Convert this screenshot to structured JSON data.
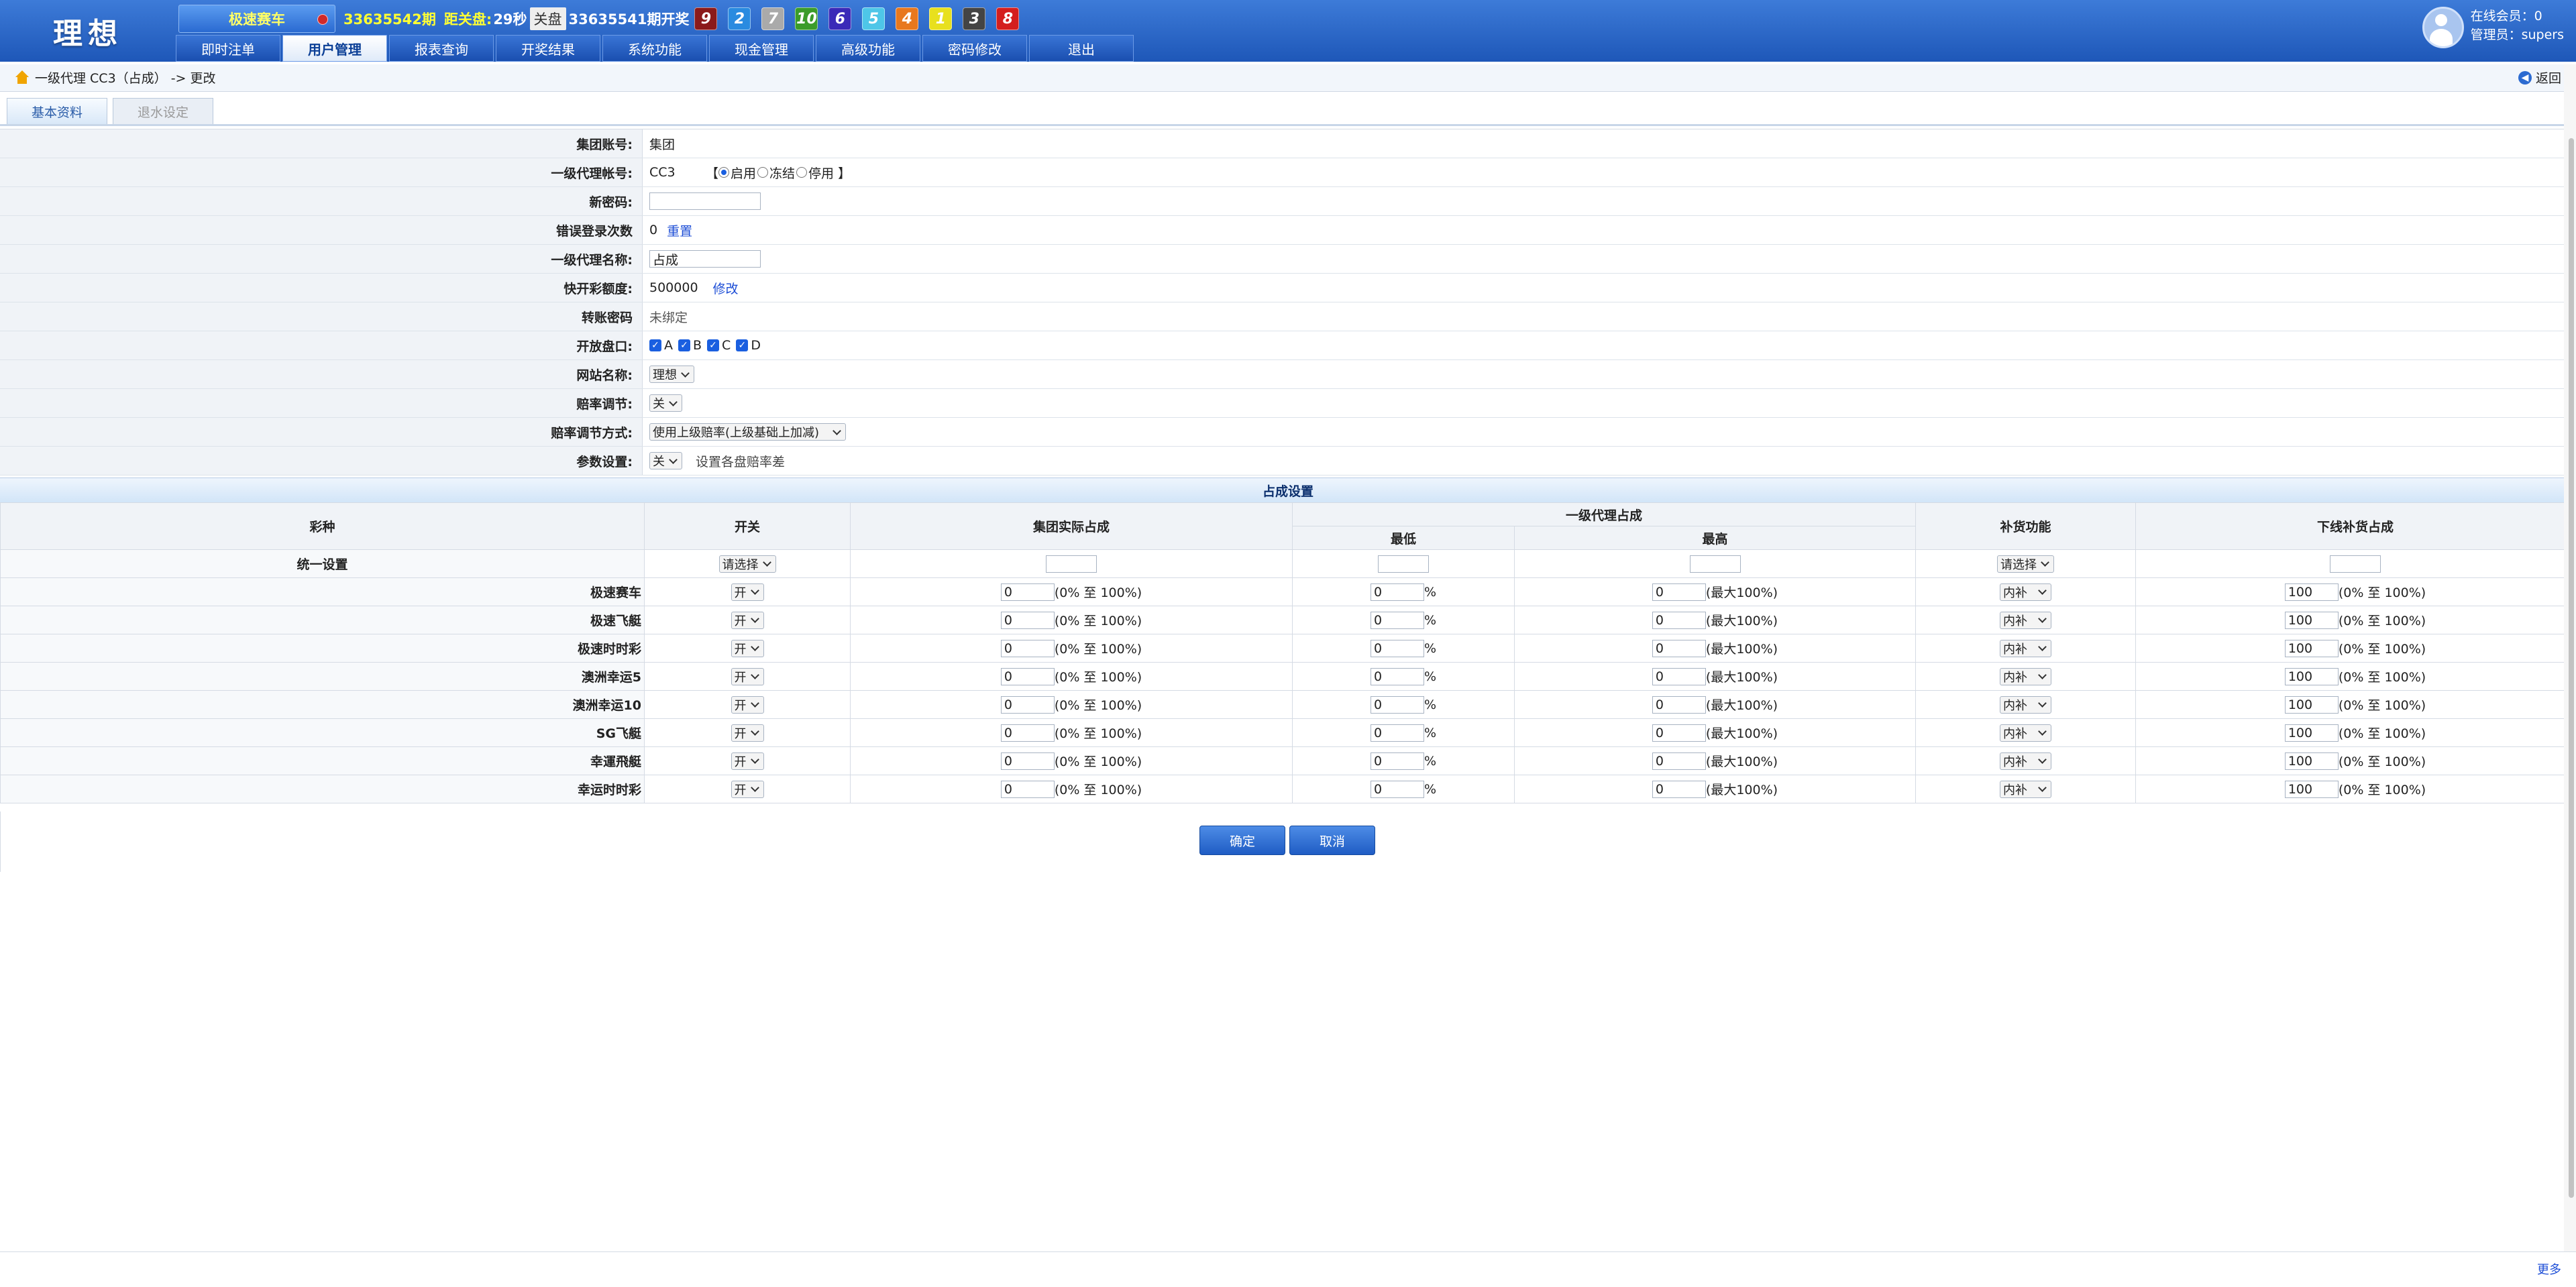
{
  "header": {
    "logo": "理想",
    "game": "极速赛车",
    "current_period": "33635542期",
    "close_label": "距关盘:",
    "close_countdown": "29秒",
    "close_badge": "关盘",
    "last_period": "33635541期开奖",
    "balls": [
      {
        "n": "9",
        "color": "#8b1a1a"
      },
      {
        "n": "2",
        "color": "#2a8be0"
      },
      {
        "n": "7",
        "color": "#aaaaaa"
      },
      {
        "n": "10",
        "color": "#3b9c2a"
      },
      {
        "n": "6",
        "color": "#3a2ab8"
      },
      {
        "n": "5",
        "color": "#4ec6e8"
      },
      {
        "n": "4",
        "color": "#e8781e"
      },
      {
        "n": "1",
        "color": "#e8e01e"
      },
      {
        "n": "3",
        "color": "#444444"
      },
      {
        "n": "8",
        "color": "#d41e1e"
      }
    ],
    "nav": [
      "即时注单",
      "用户管理",
      "报表查询",
      "开奖结果",
      "系统功能",
      "现金管理",
      "高级功能",
      "密码修改",
      "退出"
    ],
    "online_members": "在线会员：0",
    "admin": "管理员：supers"
  },
  "breadcrumb": {
    "text": "一级代理 CC3（占成） -> 更改",
    "back": "返回"
  },
  "tabs": [
    "基本资料",
    "退水设定"
  ],
  "form": {
    "group_account_label": "集团账号:",
    "group_account": "集团",
    "agent_account_label": "一级代理帐号:",
    "agent_account": "CC3",
    "bracket_open": "【",
    "bracket_close": "】",
    "status_enabled": "启用",
    "status_frozen": "冻结",
    "status_disabled": "停用",
    "new_password_label": "新密码:",
    "error_login_label": "错误登录次数",
    "error_login_count": "0",
    "reset_link": "重置",
    "agent_name_label": "一级代理名称:",
    "agent_name": "占成",
    "credit_label": "快开彩额度:",
    "credit": "500000",
    "modify_link": "修改",
    "transfer_pwd_label": "转账密码",
    "transfer_pwd": "未绑定",
    "open_plates_label": "开放盘口:",
    "plates": [
      "A",
      "B",
      "C",
      "D"
    ],
    "site_name_label": "网站名称:",
    "site_name": "理想",
    "odds_adjust_label": "赔率调节:",
    "odds_adjust": "关",
    "odds_mode_label": "赔率调节方式:",
    "odds_mode": "使用上级赔率(上级基础上加减)",
    "param_label": "参数设置:",
    "param_value": "关",
    "param_note": "设置各盘赔率差"
  },
  "share": {
    "section_title": "占成设置",
    "headers": {
      "lottery": "彩种",
      "switch": "开关",
      "group_share": "集团实际占成",
      "agent_share": "一级代理占成",
      "min": "最低",
      "max": "最高",
      "replenish": "补货功能",
      "down_replenish": "下线补货占成"
    },
    "unified_label": "统一设置",
    "please_select": "请选择",
    "rows": [
      {
        "name": "极速赛车",
        "switch": "开",
        "group": "0",
        "group_range": "(0% 至 100%)",
        "min": "0",
        "pct": "%",
        "max": "0",
        "max_note": "(最大100%)",
        "replenish": "内补",
        "down": "100",
        "down_range": "(0% 至 100%)"
      },
      {
        "name": "极速飞艇",
        "switch": "开",
        "group": "0",
        "group_range": "(0% 至 100%)",
        "min": "0",
        "pct": "%",
        "max": "0",
        "max_note": "(最大100%)",
        "replenish": "内补",
        "down": "100",
        "down_range": "(0% 至 100%)"
      },
      {
        "name": "极速时时彩",
        "switch": "开",
        "group": "0",
        "group_range": "(0% 至 100%)",
        "min": "0",
        "pct": "%",
        "max": "0",
        "max_note": "(最大100%)",
        "replenish": "内补",
        "down": "100",
        "down_range": "(0% 至 100%)"
      },
      {
        "name": "澳洲幸运5",
        "switch": "开",
        "group": "0",
        "group_range": "(0% 至 100%)",
        "min": "0",
        "pct": "%",
        "max": "0",
        "max_note": "(最大100%)",
        "replenish": "内补",
        "down": "100",
        "down_range": "(0% 至 100%)"
      },
      {
        "name": "澳洲幸运10",
        "switch": "开",
        "group": "0",
        "group_range": "(0% 至 100%)",
        "min": "0",
        "pct": "%",
        "max": "0",
        "max_note": "(最大100%)",
        "replenish": "内补",
        "down": "100",
        "down_range": "(0% 至 100%)"
      },
      {
        "name": "SG飞艇",
        "switch": "开",
        "group": "0",
        "group_range": "(0% 至 100%)",
        "min": "0",
        "pct": "%",
        "max": "0",
        "max_note": "(最大100%)",
        "replenish": "内补",
        "down": "100",
        "down_range": "(0% 至 100%)"
      },
      {
        "name": "幸運飛艇",
        "switch": "开",
        "group": "0",
        "group_range": "(0% 至 100%)",
        "min": "0",
        "pct": "%",
        "max": "0",
        "max_note": "(最大100%)",
        "replenish": "内补",
        "down": "100",
        "down_range": "(0% 至 100%)"
      },
      {
        "name": "幸运时时彩",
        "switch": "开",
        "group": "0",
        "group_range": "(0% 至 100%)",
        "min": "0",
        "pct": "%",
        "max": "0",
        "max_note": "(最大100%)",
        "replenish": "内补",
        "down": "100",
        "down_range": "(0% 至 100%)"
      }
    ]
  },
  "buttons": {
    "confirm": "确定",
    "cancel": "取消"
  },
  "footer": {
    "more": "更多"
  }
}
